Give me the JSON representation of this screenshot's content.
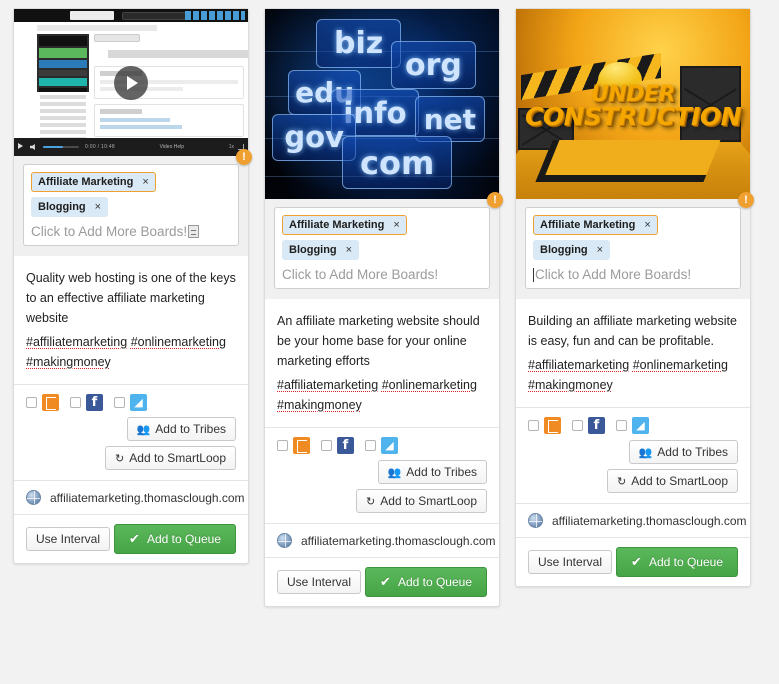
{
  "app": {
    "board_bg": "#f2f2f2",
    "accent_orange": "#f0a030",
    "queue_green": "#46a546"
  },
  "labels": {
    "add_boards_placeholder": "Click to Add More Boards!",
    "add_to_tribes": "Add to Tribes",
    "add_to_smartloop": "Add to SmartLoop",
    "use_interval": "Use Interval",
    "add_to_queue": "Add to Queue",
    "alert_badge": "!",
    "tag_remove": "×",
    "tribes_icon": "👥",
    "smartloop_icon": "↻",
    "queue_check": "✔",
    "facebook_letter": "f",
    "twitter_glyph": "◢",
    "globe_icon": "globe-icon",
    "tailwind_icon": "tailwind-icon"
  },
  "video": {
    "time_elapsed": "0:00 / 10:48",
    "center_label": "Video Help",
    "speed": "1x"
  },
  "domain_image": {
    "alt": "domain extension signs",
    "words": [
      "biz",
      "org",
      "edu",
      "info",
      "net",
      "gov",
      "com"
    ]
  },
  "construction_image": {
    "line1": "UNDER",
    "line2": "CONSTRUCTION"
  },
  "cards": [
    {
      "id": "card-1",
      "media_type": "video",
      "tags": [
        {
          "label": "Affiliate Marketing",
          "selected": true
        },
        {
          "label": "Blogging",
          "selected": false
        }
      ],
      "input_state": "spinner",
      "description": "Quality web hosting is one of the keys to an effective affiliate marketing website",
      "hashtags": [
        "#affiliatemarketing",
        "#onlinemarketing",
        "#makingmoney"
      ],
      "channels": [
        {
          "name": "tailwind",
          "checked": false
        },
        {
          "name": "facebook",
          "checked": false
        },
        {
          "name": "twitter",
          "checked": false
        }
      ],
      "url": "affiliatemarketing.thomasclough.com"
    },
    {
      "id": "card-2",
      "media_type": "domain-image",
      "tags": [
        {
          "label": "Affiliate Marketing",
          "selected": true
        },
        {
          "label": "Blogging",
          "selected": false
        }
      ],
      "input_state": "idle",
      "description": "An affiliate marketing website should be your home base for your online marketing efforts",
      "hashtags": [
        "#affiliatemarketing",
        "#onlinemarketing",
        "#makingmoney"
      ],
      "channels": [
        {
          "name": "tailwind",
          "checked": false
        },
        {
          "name": "facebook",
          "checked": false
        },
        {
          "name": "twitter",
          "checked": false
        }
      ],
      "url": "affiliatemarketing.thomasclough.com"
    },
    {
      "id": "card-3",
      "media_type": "construction-image",
      "tags": [
        {
          "label": "Affiliate Marketing",
          "selected": true
        },
        {
          "label": "Blogging",
          "selected": false
        }
      ],
      "input_state": "caret",
      "description": "Building an affiliate marketing website is easy, fun and can be profitable.",
      "hashtags": [
        "#affiliatemarketing",
        "#onlinemarketing",
        "#makingmoney"
      ],
      "channels": [
        {
          "name": "tailwind",
          "checked": false
        },
        {
          "name": "facebook",
          "checked": false
        },
        {
          "name": "twitter",
          "checked": false
        }
      ],
      "url": "affiliatemarketing.thomasclough.com"
    }
  ]
}
